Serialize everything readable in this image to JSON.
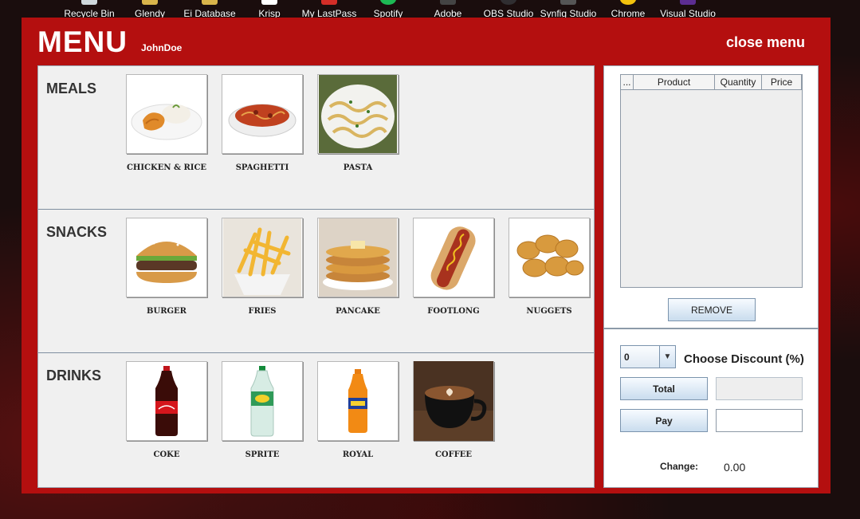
{
  "desktop_icons": [
    {
      "label": "Recycle Bin",
      "icon": "recycle-bin-icon",
      "color": "#cfd8dc"
    },
    {
      "label": "Glendy",
      "icon": "folder-icon",
      "color": "#d9b44a"
    },
    {
      "label": "Ei Database",
      "icon": "folder-icon",
      "color": "#d9b44a"
    },
    {
      "label": "Krisp",
      "icon": "krisp-icon",
      "color": "#ffffff"
    },
    {
      "label": "My LastPass",
      "icon": "lastpass-icon",
      "color": "#d32d27"
    },
    {
      "label": "Spotify",
      "icon": "spotify-icon",
      "color": "#1db954"
    },
    {
      "label": "Adobe",
      "icon": "adobe-icon",
      "color": "#444444"
    },
    {
      "label": "OBS Studio",
      "icon": "obs-icon",
      "color": "#302e31"
    },
    {
      "label": "Synfig Studio",
      "icon": "synfig-icon",
      "color": "#555555"
    },
    {
      "label": "Chrome",
      "icon": "chrome-icon",
      "color": "#f4c20d"
    },
    {
      "label": "Visual Studio",
      "icon": "visual-studio-icon",
      "color": "#5c2d91"
    }
  ],
  "header": {
    "title": "MENU",
    "user": "JohnDoe",
    "close_label": "close menu"
  },
  "catalog": {
    "sections": [
      {
        "title": "MEALS",
        "items": [
          {
            "label": "CHICKEN & RICE",
            "image": "chicken-rice-image"
          },
          {
            "label": "SPAGHETTI",
            "image": "spaghetti-image"
          },
          {
            "label": "PASTA",
            "image": "pasta-image"
          }
        ]
      },
      {
        "title": "SNACKS",
        "items": [
          {
            "label": "BURGER",
            "image": "burger-image"
          },
          {
            "label": "FRIES",
            "image": "fries-image"
          },
          {
            "label": "PANCAKE",
            "image": "pancake-image"
          },
          {
            "label": "FOOTLONG",
            "image": "footlong-image"
          },
          {
            "label": "NUGGETS",
            "image": "nuggets-image"
          }
        ]
      },
      {
        "title": "DRINKS",
        "items": [
          {
            "label": "COKE",
            "image": "coke-image"
          },
          {
            "label": "SPRITE",
            "image": "sprite-image"
          },
          {
            "label": "ROYAL",
            "image": "royal-image"
          },
          {
            "label": "COFFEE",
            "image": "coffee-image"
          }
        ]
      }
    ]
  },
  "cart": {
    "columns": [
      "...",
      "Product",
      "Quantity",
      "Price"
    ],
    "rows": [],
    "remove_label": "REMOVE"
  },
  "payment": {
    "discount_value": "0",
    "discount_label": "Choose Discount (%)",
    "total_label": "Total",
    "total_value": "",
    "pay_label": "Pay",
    "pay_value": "",
    "change_label": "Change:",
    "change_value": "0.00"
  },
  "colors": {
    "window_red": "#b40f0f",
    "panel_gray": "#f0f0f0",
    "button_blue": "#c9dcee"
  }
}
